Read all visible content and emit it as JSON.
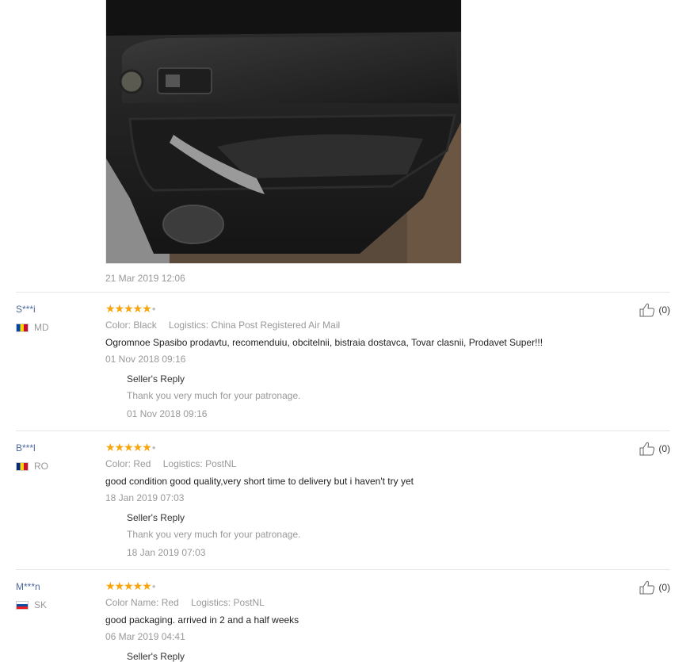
{
  "photo": {
    "alt_icon": "car-door-photo"
  },
  "first_review_date": "21 Mar 2019 12:06",
  "feedbacks": [
    {
      "user": "S***i",
      "country": "MD",
      "rating": 5,
      "stars": "★★★★★",
      "color_label": "Color:",
      "color_value": "Black",
      "logistics_label": "Logistics:",
      "logistics_value": "China Post Registered Air Mail",
      "text": "Ogromnoe Spasibo prodavtu, recomenduiu, obcitelnii, bistraia dostavca, Tovar clasnii, Prodavet Super!!!",
      "date": "01 Nov 2018 09:16",
      "reply_title": "Seller's Reply",
      "reply_text": "Thank you very much for your patronage.",
      "reply_date": "01 Nov 2018 09:16",
      "helpful": "(0)"
    },
    {
      "user": "B***l",
      "country": "RO",
      "rating": 5,
      "stars": "★★★★★",
      "color_label": "Color:",
      "color_value": "Red",
      "logistics_label": "Logistics:",
      "logistics_value": "PostNL",
      "text": "good condition good quality,very short time to delivery but i haven't try yet",
      "date": "18 Jan 2019 07:03",
      "reply_title": "Seller's Reply",
      "reply_text": "Thank you very much for your patronage.",
      "reply_date": "18 Jan 2019 07:03",
      "helpful": "(0)"
    },
    {
      "user": "M***n",
      "country": "SK",
      "rating": 5,
      "stars": "★★★★★",
      "color_label": "Color Name:",
      "color_value": "Red",
      "logistics_label": "Logistics:",
      "logistics_value": "PostNL",
      "text": "good packaging. arrived in 2 and a half weeks",
      "date": "06 Mar 2019 04:41",
      "reply_title": "Seller's Reply",
      "helpful": "(0)"
    }
  ],
  "colors": {
    "star": "#f7a50a",
    "username": "#4c6a9c",
    "muted": "#999999"
  }
}
